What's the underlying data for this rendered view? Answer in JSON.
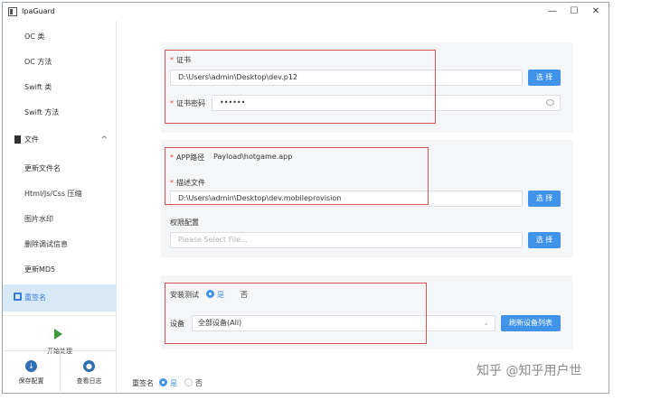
{
  "window": {
    "title": "IpaGuard",
    "minimize": "—",
    "maximize": "☐",
    "close": "✕"
  },
  "sidebar": {
    "items": [
      {
        "label": "OC 类"
      },
      {
        "label": "OC 方法"
      },
      {
        "label": "Swift 类"
      },
      {
        "label": "Swift 方法"
      }
    ],
    "file_group": {
      "label": "文件",
      "chevron": "^"
    },
    "file_items": [
      {
        "label": "更新文件名"
      },
      {
        "label": "Html/Js/Css 压缩"
      },
      {
        "label": "图片水印"
      },
      {
        "label": "删除调试信息"
      },
      {
        "label": "更新MD5"
      }
    ],
    "active_item": {
      "label": "重签名"
    },
    "start_button": {
      "label": "开始处理"
    },
    "save_config": {
      "label": "保存配置",
      "icon": "↓"
    },
    "view_log": {
      "label": "查看日志",
      "icon": "●"
    }
  },
  "certificate": {
    "cert_label": "证书",
    "cert_value": "D:\\Users\\admin\\Desktop\\dev.p12",
    "cert_button": "选 择",
    "password_label": "证书密码",
    "password_value": "••••••",
    "required_mark": "*"
  },
  "provision": {
    "app_path_label": "APP路径",
    "app_path_value": "Payload\\hotgame.app",
    "profile_label": "描述文件",
    "profile_value": "D:\\Users\\admin\\Desktop\\dev.mobileprovision",
    "profile_button": "选 择",
    "entitlements_label": "权限配置",
    "entitlements_placeholder": "Please Select File...",
    "entitlements_button": "选 择",
    "required_mark": "*"
  },
  "install": {
    "test_label": "安装测试",
    "yes": "是",
    "no": "否",
    "device_label": "设备",
    "device_value": "全部设备(All)",
    "refresh_button": "刷新设备列表"
  },
  "resign": {
    "label": "重签名",
    "yes": "是",
    "no": "否"
  },
  "watermark": "知乎 @知乎用户世"
}
